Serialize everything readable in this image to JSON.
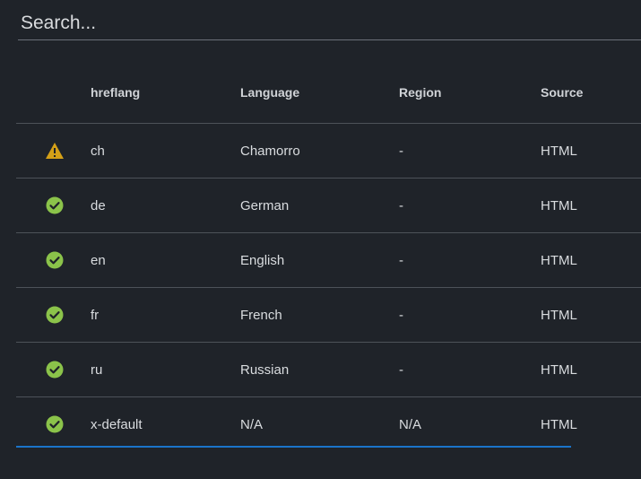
{
  "search": {
    "placeholder": "Search..."
  },
  "colors": {
    "background": "#1f2329",
    "ok": "#8bc34a",
    "warning": "#d4a017",
    "accent_line": "#1a73c9"
  },
  "table": {
    "headers": {
      "status": "",
      "hreflang": "hreflang",
      "language": "Language",
      "region": "Region",
      "source": "Source"
    },
    "rows": [
      {
        "status": "warning-icon",
        "hreflang": "ch",
        "language": "Chamorro",
        "region": "-",
        "source": "HTML"
      },
      {
        "status": "check-circle-icon",
        "hreflang": "de",
        "language": "German",
        "region": "-",
        "source": "HTML"
      },
      {
        "status": "check-circle-icon",
        "hreflang": "en",
        "language": "English",
        "region": "-",
        "source": "HTML"
      },
      {
        "status": "check-circle-icon",
        "hreflang": "fr",
        "language": "French",
        "region": "-",
        "source": "HTML"
      },
      {
        "status": "check-circle-icon",
        "hreflang": "ru",
        "language": "Russian",
        "region": "-",
        "source": "HTML"
      },
      {
        "status": "check-circle-icon",
        "hreflang": "x-default",
        "language": "N/A",
        "region": "N/A",
        "source": "HTML"
      }
    ]
  }
}
